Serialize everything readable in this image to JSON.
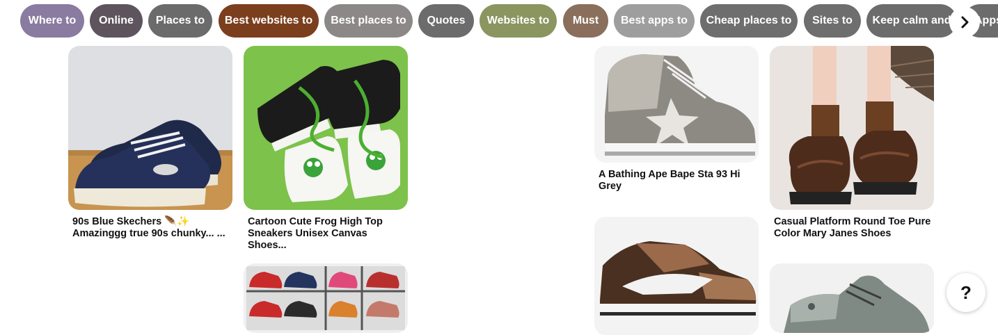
{
  "chips": [
    {
      "label": "Where to",
      "color": "#8a7ba0"
    },
    {
      "label": "Online",
      "color": "#5e545e"
    },
    {
      "label": "Places to",
      "color": "#6b6b6b"
    },
    {
      "label": "Best websites to",
      "color": "#7b3f1e"
    },
    {
      "label": "Best places to",
      "color": "#8c8888"
    },
    {
      "label": "Quotes",
      "color": "#6c6c6c"
    },
    {
      "label": "Websites to",
      "color": "#8a9560"
    },
    {
      "label": "Must",
      "color": "#8a6f5d"
    },
    {
      "label": "Best apps to",
      "color": "#9e9e9e"
    },
    {
      "label": "Cheap places to",
      "color": "#6e6e6e"
    },
    {
      "label": "Sites to",
      "color": "#6e6e6e"
    },
    {
      "label": "Keep calm and",
      "color": "#6c6c6c"
    },
    {
      "label": "Apps",
      "color": "#6c6c6c"
    }
  ],
  "next_icon": "chevron-right-icon",
  "pins": [
    {
      "title": "90s Blue Skechers 🪶✨ Amazinggg true 90s chunky... ..."
    },
    {
      "title": "Cartoon Cute Frog High Top Sneakers Unisex Canvas Shoes..."
    },
    {
      "title": ""
    },
    {
      "title": "A Bathing Ape Bape Sta 93 Hi Grey"
    },
    {
      "title": ""
    },
    {
      "title": "Casual Platform Round Toe Pure Color Mary Janes Shoes"
    },
    {
      "title": ""
    }
  ],
  "help": {
    "label": "?"
  }
}
